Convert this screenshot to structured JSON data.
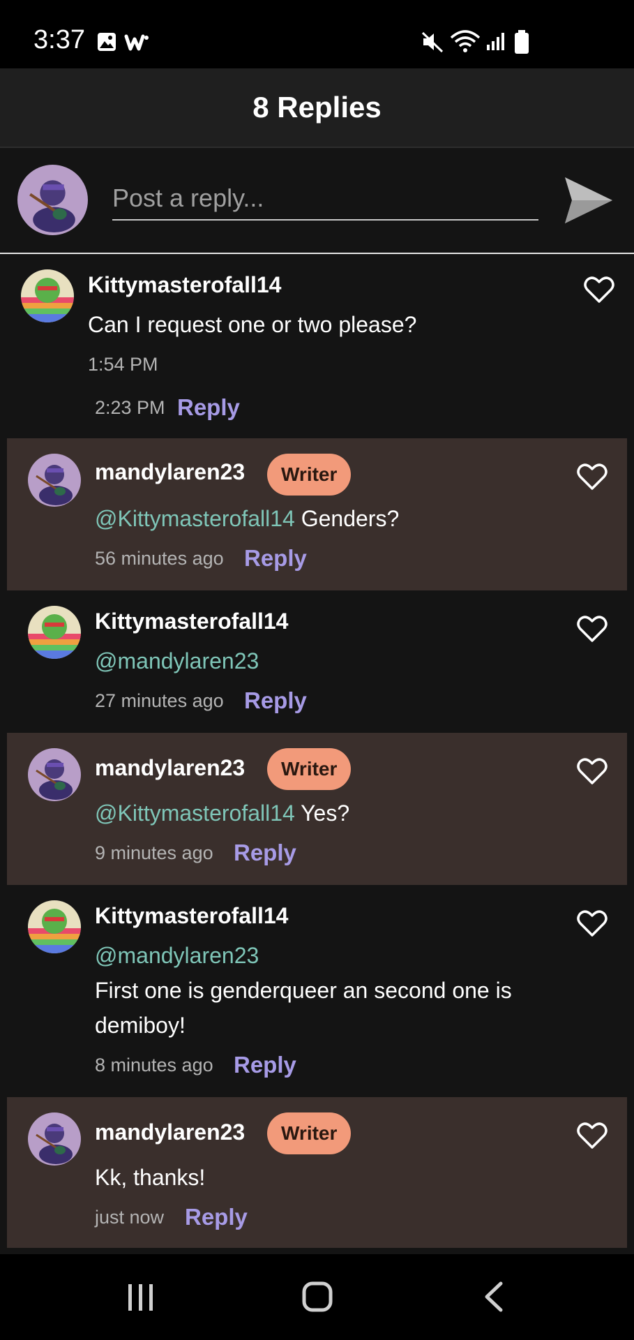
{
  "status_bar": {
    "time": "3:37",
    "icons": [
      "image-icon",
      "w-app-icon",
      "mute-icon",
      "wifi-icon",
      "signal-icon",
      "battery-icon"
    ]
  },
  "header": {
    "title": "8 Replies"
  },
  "composer": {
    "placeholder": "Post a reply...",
    "send_icon": "send-icon"
  },
  "comments": [
    {
      "user": "Kittymasterofall14",
      "is_writer": false,
      "text": "Can I request one or two please?",
      "time": "1:54 PM",
      "reply_time": "2:23 PM",
      "reply_label": "Reply",
      "avatar": "green-avatar"
    },
    {
      "user": "mandylaren23",
      "is_writer": true,
      "badge": "Writer",
      "mention": "@Kittymasterofall14",
      "text": "Genders?",
      "time": "56 minutes ago",
      "reply_label": "Reply",
      "avatar": "purple-avatar"
    },
    {
      "user": "Kittymasterofall14",
      "is_writer": false,
      "mention": "@mandylaren23",
      "text": "",
      "time": "27 minutes ago",
      "reply_label": "Reply",
      "avatar": "green-avatar"
    },
    {
      "user": "mandylaren23",
      "is_writer": true,
      "badge": "Writer",
      "mention": "@Kittymasterofall14",
      "text": "Yes?",
      "time": "9 minutes ago",
      "reply_label": "Reply",
      "avatar": "purple-avatar"
    },
    {
      "user": "Kittymasterofall14",
      "is_writer": false,
      "mention": "@mandylaren23",
      "text": "First one is genderqueer an second one is demiboy!",
      "time": "8 minutes ago",
      "reply_label": "Reply",
      "avatar": "green-avatar"
    },
    {
      "user": "mandylaren23",
      "is_writer": true,
      "badge": "Writer",
      "text": "Kk, thanks!",
      "time": "just now",
      "reply_label": "Reply",
      "avatar": "purple-avatar"
    }
  ],
  "nav_bar": {
    "buttons": [
      "recent-apps-icon",
      "home-icon",
      "back-icon"
    ]
  },
  "colors": {
    "background": "#141414",
    "writer_row": "#3a2f2c",
    "writer_badge": "#f29a7a",
    "mention": "#7fc6b8",
    "reply_link": "#a79be6"
  }
}
